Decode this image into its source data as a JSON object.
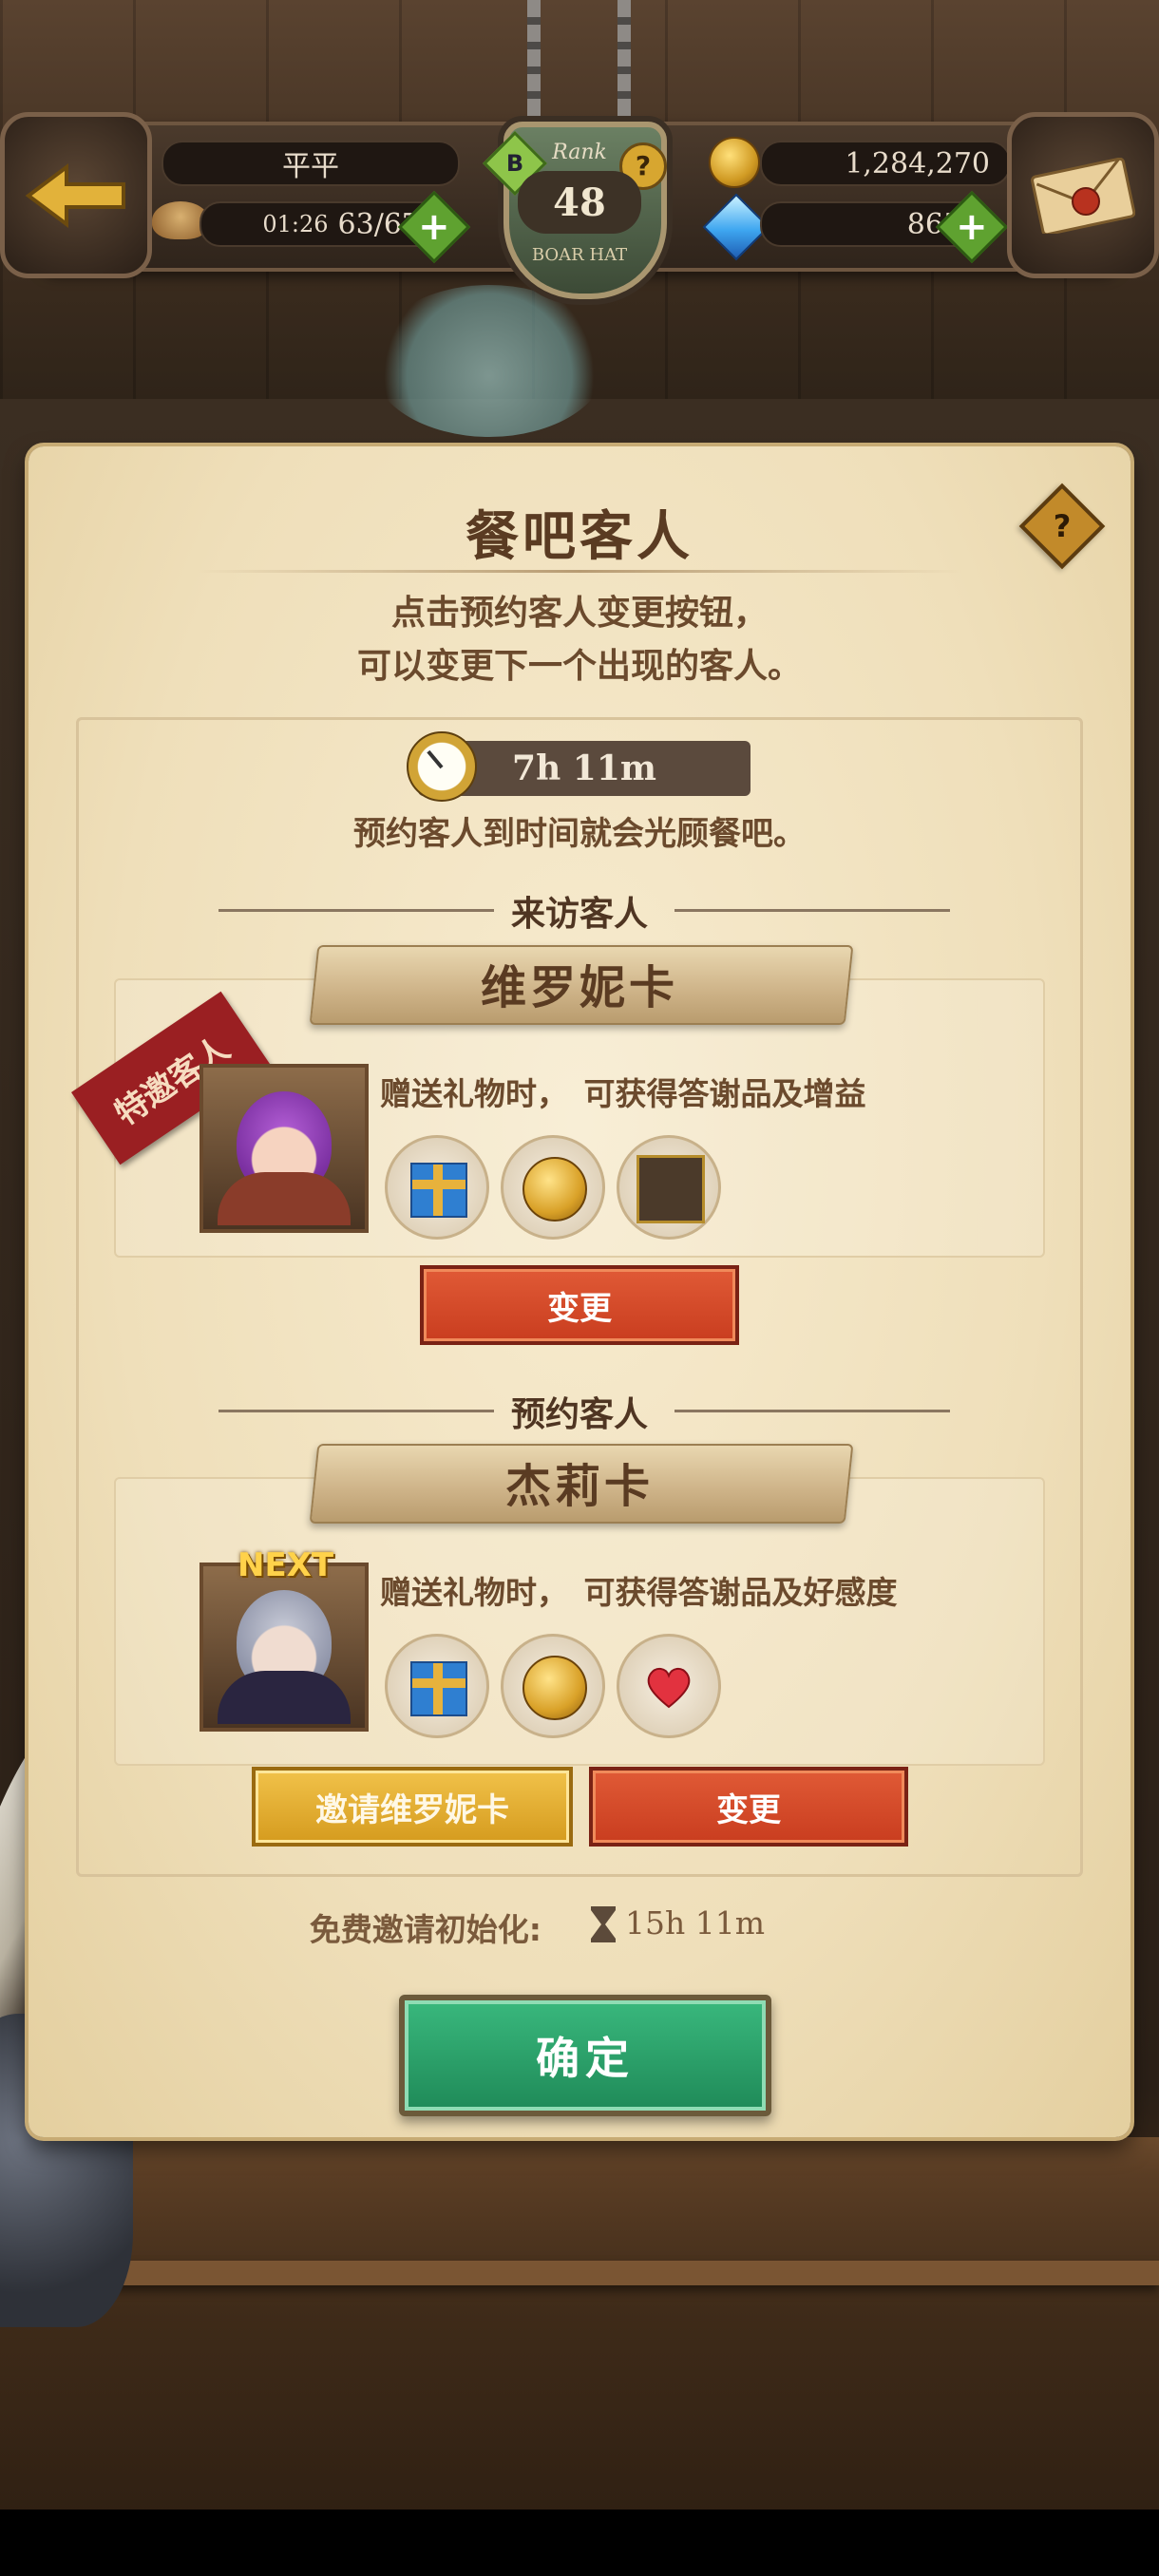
{
  "hud": {
    "player_name": "平平",
    "stamina_timer": "01:26",
    "stamina": "63/67",
    "rank_label": "Rank",
    "rank_level": "48",
    "tavern_name": "BOAR HAT",
    "rank_badge": "B",
    "gold": "1,284,270",
    "gems": "865",
    "plus": "+",
    "help": "?"
  },
  "panel": {
    "title": "餐吧客人",
    "help": "?",
    "description_line1": "点击预约客人变更按钮，",
    "description_line2": "可以变更下一个出现的客人。",
    "timer": "7h 11m",
    "timer_note": "预约客人到时间就会光顾餐吧。"
  },
  "visiting": {
    "section_title": "来访客人",
    "tag": "特邀客人",
    "name": "维罗妮卡",
    "gift_desc": "赠送礼物时，　可获得答谢品及增益",
    "rewards": [
      "gift-box-icon",
      "gold-coin-icon",
      "item-bag-icon"
    ],
    "change_label": "变更"
  },
  "reserved": {
    "section_title": "预约客人",
    "next_label": "NEXT",
    "name": "杰莉卡",
    "gift_desc": "赠送礼物时，　可获得答谢品及好感度",
    "rewards": [
      "gift-box-icon",
      "gold-coin-icon",
      "heart-icon"
    ],
    "invite_label": "邀请维罗妮卡",
    "change_label": "变更"
  },
  "footer": {
    "reset_label": "免费邀请初始化:",
    "reset_time": "15h 11m",
    "confirm_label": "确定"
  },
  "colors": {
    "parchment": "#efdfba",
    "red_button": "#d14a28",
    "gold_button": "#e3ae33",
    "green_button": "#2aa46a",
    "text_brown": "#6b4a2d"
  }
}
